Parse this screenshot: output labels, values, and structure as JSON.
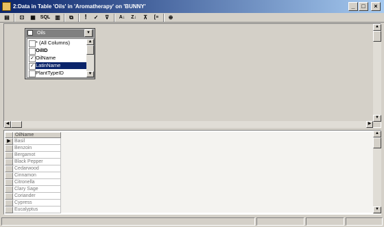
{
  "window": {
    "title": "2:Data in Table 'Oils' in 'Aromatherapy' on 'BUNNY'",
    "min_glyph": "_",
    "max_glyph": "□",
    "close_glyph": "×"
  },
  "toolbar": {
    "buttons": [
      {
        "name": "properties-button",
        "glyph": "▤"
      },
      {
        "name": "show-diagram-pane-button",
        "glyph": "⊡"
      },
      {
        "name": "show-grid-pane-button",
        "glyph": "▦"
      },
      {
        "name": "show-sql-pane-button",
        "glyph": "SQL"
      },
      {
        "name": "show-results-pane-button",
        "glyph": "▥"
      },
      {
        "name": "change-query-type-button",
        "glyph": "⧉"
      },
      {
        "name": "run-button",
        "glyph": "!"
      },
      {
        "name": "verify-sql-button",
        "glyph": "✓"
      },
      {
        "name": "remove-filter-button",
        "glyph": "⊽"
      },
      {
        "name": "sort-ascending-button",
        "glyph": "A↓"
      },
      {
        "name": "sort-descending-button",
        "glyph": "Z↓"
      },
      {
        "name": "filter-button",
        "glyph": "⊼"
      },
      {
        "name": "group-by-button",
        "glyph": "[≡"
      },
      {
        "name": "add-table-button",
        "glyph": "⊕"
      }
    ]
  },
  "table_box": {
    "title": "Oils",
    "columns": [
      {
        "label": "* (All Columns)",
        "checked": false,
        "bold": false,
        "selected": false
      },
      {
        "label": "OilID",
        "checked": false,
        "bold": true,
        "selected": false
      },
      {
        "label": "OilName",
        "checked": true,
        "bold": false,
        "selected": false
      },
      {
        "label": "LatinName",
        "checked": true,
        "bold": false,
        "selected": true
      },
      {
        "label": "PlantTypeID",
        "checked": false,
        "bold": false,
        "selected": false
      }
    ],
    "check_glyph": "✓"
  },
  "grid": {
    "column_header": "OilName",
    "current_row_glyph": "▶",
    "rows": [
      "Basil",
      "Benzoin",
      "Bergamot",
      "Black Pepper",
      "Cedarwood",
      "Cinnamon",
      "Citronella",
      "Clary Sage",
      "Coriander",
      "Cypress",
      "Eucalyptus"
    ]
  },
  "scroll": {
    "up": "▲",
    "down": "▼",
    "left": "◀",
    "right": "▶"
  }
}
